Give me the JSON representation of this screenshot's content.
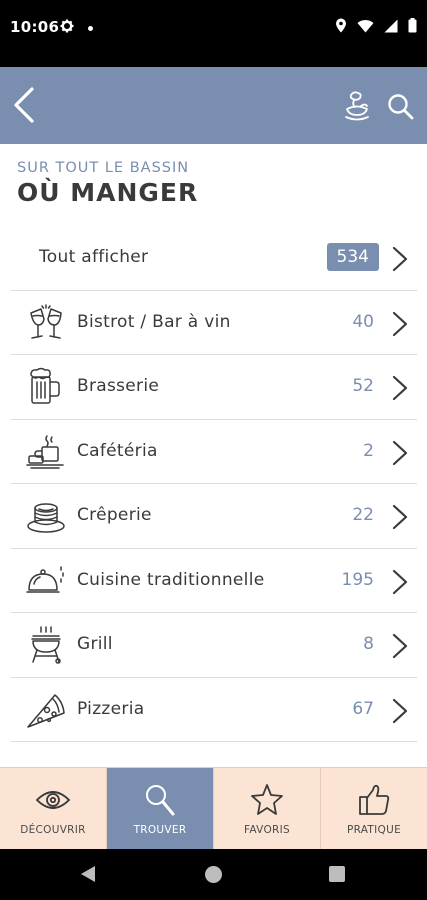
{
  "status_bar": {
    "time": "10:06"
  },
  "header": {
    "subtitle": "SUR TOUT LE BASSIN",
    "title": "OÙ MANGER"
  },
  "list": {
    "all": {
      "label": "Tout afficher",
      "count": "534"
    },
    "items": [
      {
        "label": "Bistrot / Bar à vin",
        "count": "40",
        "icon": "wine-glasses-icon"
      },
      {
        "label": "Brasserie",
        "count": "52",
        "icon": "beer-mug-icon"
      },
      {
        "label": "Cafétéria",
        "count": "2",
        "icon": "coffee-cup-icon"
      },
      {
        "label": "Crêperie",
        "count": "22",
        "icon": "crepe-stack-icon"
      },
      {
        "label": "Cuisine traditionnelle",
        "count": "195",
        "icon": "cloche-icon"
      },
      {
        "label": "Grill",
        "count": "8",
        "icon": "bbq-grill-icon"
      },
      {
        "label": "Pizzeria",
        "count": "67",
        "icon": "pizza-slice-icon"
      }
    ]
  },
  "bottom_nav": [
    {
      "label": "DÉCOUVRIR",
      "icon": "eye-icon",
      "active": false
    },
    {
      "label": "TROUVER",
      "icon": "magnifier-icon",
      "active": true
    },
    {
      "label": "FAVORIS",
      "icon": "star-icon",
      "active": false
    },
    {
      "label": "PRATIQUE",
      "icon": "thumbs-up-icon",
      "active": false
    }
  ],
  "colors": {
    "accent": "#7a8eaf",
    "nav_background": "#fbe4d3",
    "text": "#3a3a3a"
  }
}
